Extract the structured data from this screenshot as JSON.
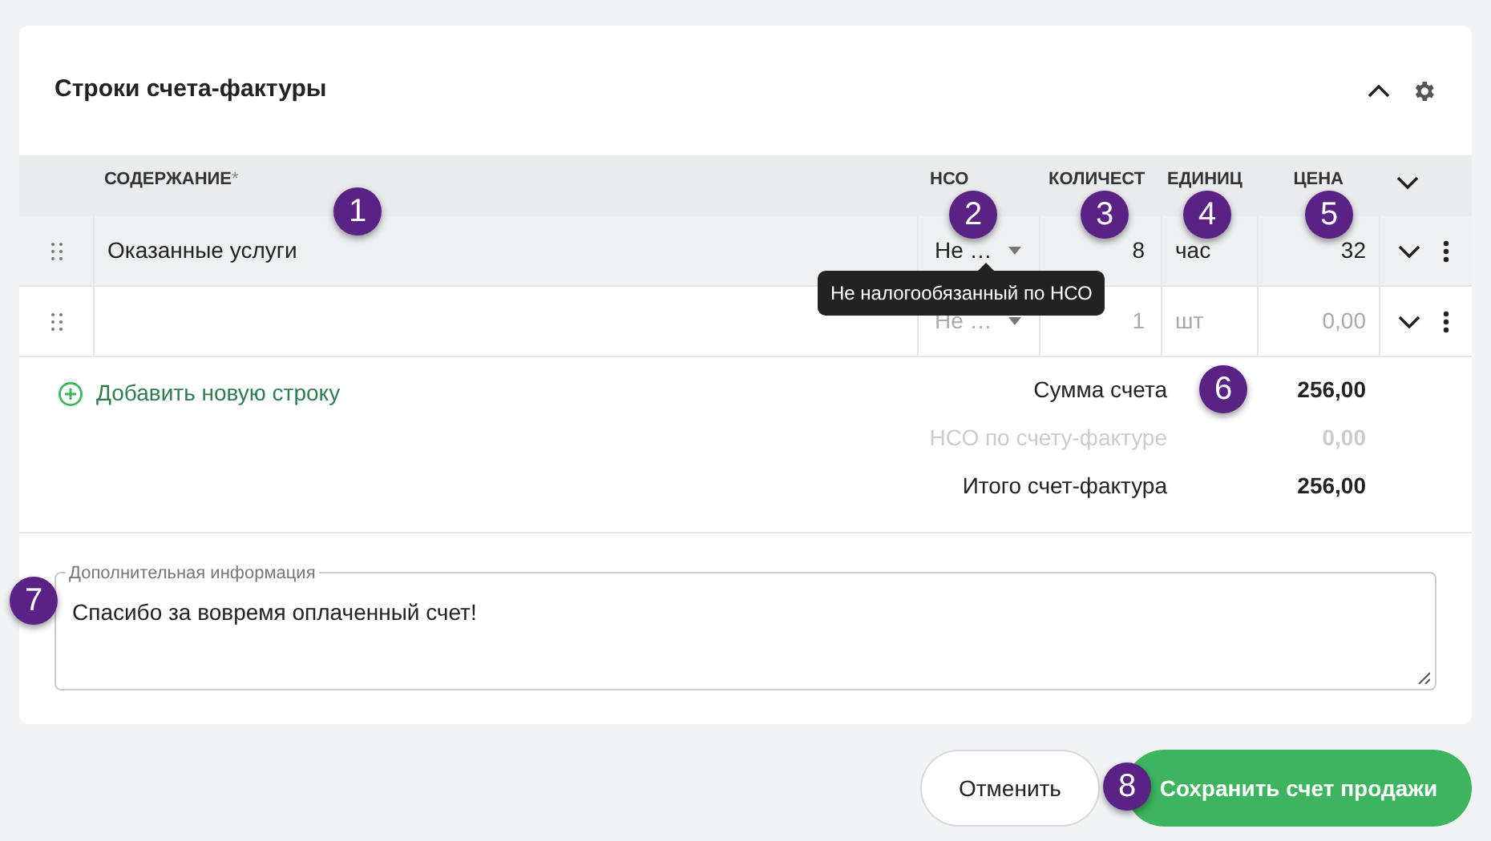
{
  "section": {
    "title": "Строки счета-фактуры",
    "expanded": true
  },
  "columns": [
    {
      "label": "СОДЕРЖАНИЕ",
      "required_mark": "*"
    },
    {
      "label": "НСО"
    },
    {
      "label": "КОЛИЧЕСТ"
    },
    {
      "label": "ЕДИНИЦ"
    },
    {
      "label": "ЦЕНА"
    }
  ],
  "rows": [
    {
      "hovered": true,
      "muted": false,
      "content": "Оказанные услуги",
      "nso": "Не …",
      "qty": "8",
      "unit": "час",
      "price": "32"
    },
    {
      "hovered": false,
      "muted": true,
      "content": "",
      "nso": "Не …",
      "qty": "1",
      "unit": "шт",
      "price": "0,00"
    }
  ],
  "tooltip": "Не налогообязанный по НСО",
  "add_row": "Добавить новую строку",
  "totals": [
    {
      "label": "Сумма счета",
      "value": "256,00",
      "muted": false
    },
    {
      "label": "НСО по счету-фактуре",
      "value": "0,00",
      "muted": true
    },
    {
      "label": "Итого счет-фактура",
      "value": "256,00",
      "muted": false
    }
  ],
  "notes": {
    "label": "Дополнительная информация",
    "value": "Спасибо за вовремя оплаченный счет!"
  },
  "buttons": [
    {
      "label": "Отменить",
      "kind": "secondary"
    },
    {
      "label": "Сохранить счет продажи",
      "kind": "primary"
    }
  ],
  "callouts": [
    "1",
    "2",
    "3",
    "4",
    "5",
    "6",
    "7",
    "8"
  ]
}
